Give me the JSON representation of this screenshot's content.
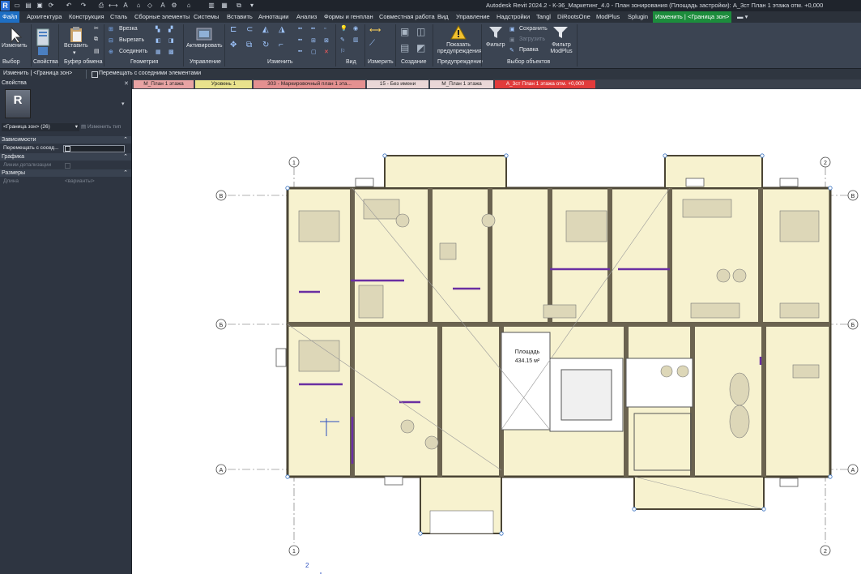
{
  "title": "Autodesk Revit 2024.2 - К-36_Маркетинг_4.0 - План зонирования (Площадь застройки): А_3ст План 1 этажа отм. +0,000",
  "menu_tabs": [
    "Файл",
    "Архитектура",
    "Конструкция",
    "Сталь",
    "Сборные элементы",
    "Системы",
    "Вставить",
    "Аннотации",
    "Анализ",
    "Формы и генплан",
    "Совместная работа",
    "Вид",
    "Управление",
    "Надстройки",
    "Tangl",
    "DiRootsOne",
    "ModPlus",
    "Splugin",
    "Изменить | <Граница зон>"
  ],
  "ribbon": {
    "modify_label": "Изменить",
    "paste_label": "Вставить",
    "cut_label": "Врезка",
    "cut2_label": "Вырезать",
    "join_label": "Соединить",
    "activate_label": "Активировать",
    "show_warnings_label": "Показать предупреждения",
    "filter_label": "Фильтр",
    "save_label": "Сохранить",
    "load_label": "Загрузить",
    "edit_label": "Правка",
    "filter_modplus_label": "Фильтр ModPlus",
    "groups": [
      "Выбор",
      "Свойства",
      "Буфер обмена",
      "Геометрия",
      "Управление",
      "Изменить",
      "Вид",
      "Измерить",
      "Создание",
      "Предупреждение",
      "Выбор объектов"
    ]
  },
  "optbar": {
    "context": "Изменить | <Граница зон>",
    "checkbox_label": "Перемещать с соседними элементами"
  },
  "props": {
    "header": "Свойства",
    "type_selector": "<Граница зон> (26)",
    "edit_type": "Изменить тип",
    "sections": [
      {
        "title": "Зависимости",
        "rows": [
          {
            "name": "Перемещать с сосед...",
            "value": ""
          }
        ]
      },
      {
        "title": "Графика",
        "rows": [
          {
            "name": "Линии детализации",
            "value": ""
          }
        ]
      },
      {
        "title": "Размеры",
        "rows": [
          {
            "name": "Длина",
            "value": "<варианты>"
          }
        ]
      }
    ]
  },
  "view_tabs": [
    {
      "label": "М_План 1 этажа",
      "color": "#e8a3a3"
    },
    {
      "label": "Уровень 1",
      "color": "#e9e28c"
    },
    {
      "label": "303 - Маркировочный план 1 эта...",
      "color": "#e49090"
    },
    {
      "label": "15 - Без имени",
      "color": "#ead7d7"
    },
    {
      "label": "М_План 1 этажа",
      "color": "#ead7d7"
    },
    {
      "label": "А_3ст План 1 этажа отм. +0,000",
      "color": "#e23b3b"
    }
  ],
  "plan": {
    "grid_cols": [
      "1",
      "2"
    ],
    "grid_rows": [
      "В",
      "Б",
      "А"
    ],
    "area_label": "Площадь",
    "area_value": "434.15 м²",
    "bottom_mark": "2"
  }
}
